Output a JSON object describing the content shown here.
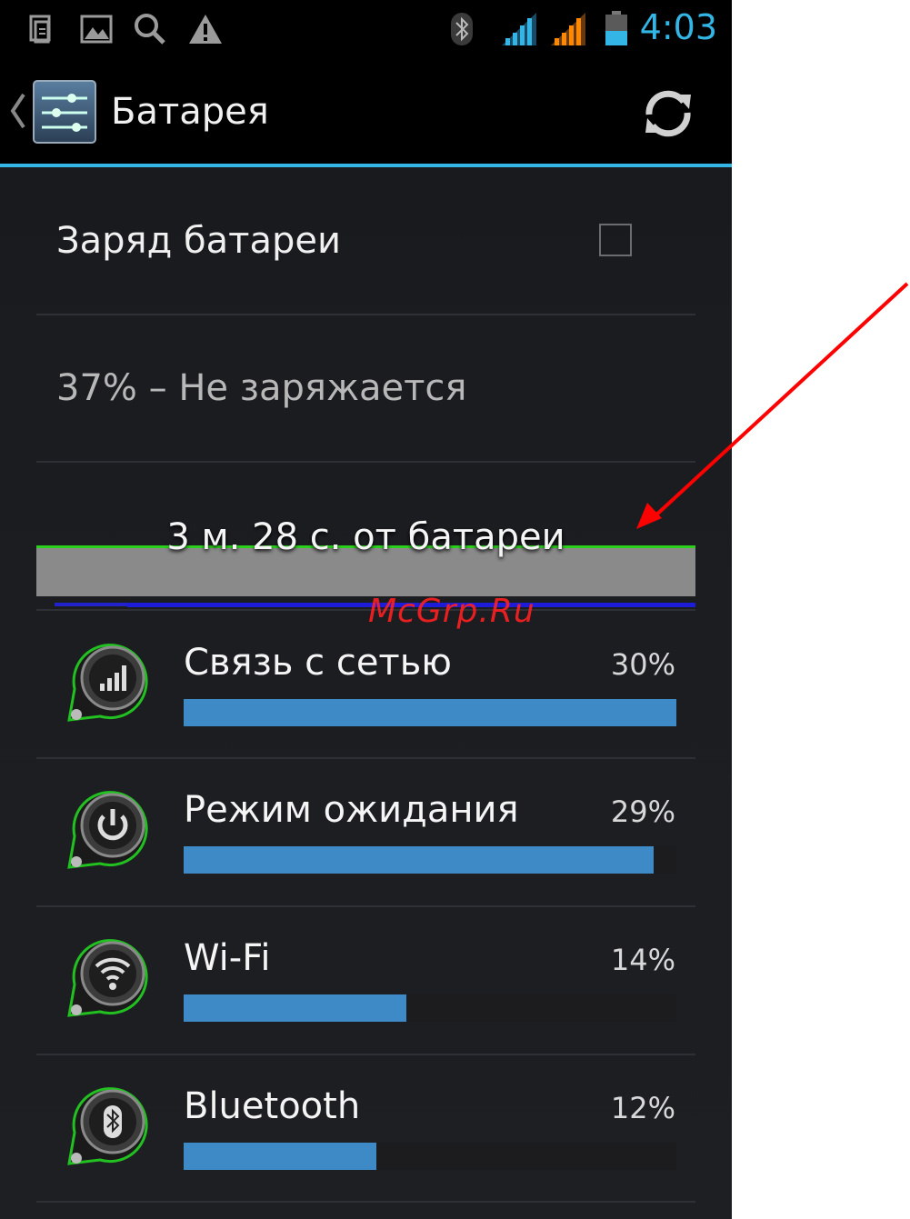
{
  "status_bar": {
    "time": "4:03",
    "icons": [
      "clipboard-icon",
      "image-icon",
      "search-icon",
      "warning-icon",
      "bluetooth-icon",
      "signal-sim1-icon",
      "signal-sim2-icon",
      "battery-icon"
    ],
    "colors": {
      "accent": "#33b5e5",
      "sim2": "#ff8800"
    }
  },
  "action_bar": {
    "title": "Батарея",
    "back_icon": "chevron-left-icon",
    "app_icon": "settings-sliders-icon",
    "refresh_icon": "refresh-icon"
  },
  "settings": {
    "charge_label": "Заряд батареи",
    "charge_checked": false,
    "status": "37% – Не заряжается",
    "graph_label": "3 м. 28 с. от батареи"
  },
  "usage": [
    {
      "name": "Связь с сетью",
      "percent_label": "30%",
      "fill": 1.0,
      "icon": "cell-signal-icon"
    },
    {
      "name": "Режим ожидания",
      "percent_label": "29%",
      "fill": 0.953,
      "icon": "power-icon"
    },
    {
      "name": "Wi-Fi",
      "percent_label": "14%",
      "fill": 0.452,
      "icon": "wifi-icon"
    },
    {
      "name": "Bluetooth",
      "percent_label": "12%",
      "fill": 0.391,
      "icon": "bluetooth-icon"
    }
  ],
  "watermark": "McGrp.Ru",
  "colors": {
    "bar": "#3d8ac6",
    "graph_green": "#2bd01c",
    "arrow": "#ff0000"
  }
}
